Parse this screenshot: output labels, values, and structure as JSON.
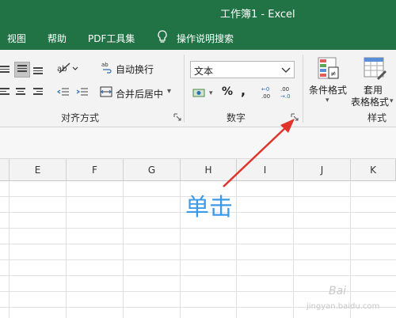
{
  "window": {
    "title": "工作簿1  -  Excel"
  },
  "menu": {
    "items": [
      "视图",
      "帮助",
      "PDF工具集"
    ],
    "tell_me": "操作说明搜索"
  },
  "ribbon": {
    "alignment": {
      "wrap_text": "自动换行",
      "merge_center": "合并后居中",
      "merge_center_arrow": "▾",
      "label": "对齐方式"
    },
    "number": {
      "format_value": "文本",
      "percent": "%",
      "comma": ",",
      "label": "数字"
    },
    "styles": {
      "conditional_formatting": "条件格式",
      "format_as_table_line1": "套用",
      "format_as_table_line2": "表格格式",
      "label": "样式"
    }
  },
  "columns": [
    "E",
    "F",
    "G",
    "H",
    "I",
    "J",
    "K"
  ],
  "annotation": {
    "text": "单击",
    "color": "#3d9ae8",
    "arrow_color": "#e0332a"
  },
  "watermark": {
    "line1": "Bai",
    "line2": "jingyan.baidu.com"
  },
  "theme": {
    "excel_green": "#217346"
  }
}
